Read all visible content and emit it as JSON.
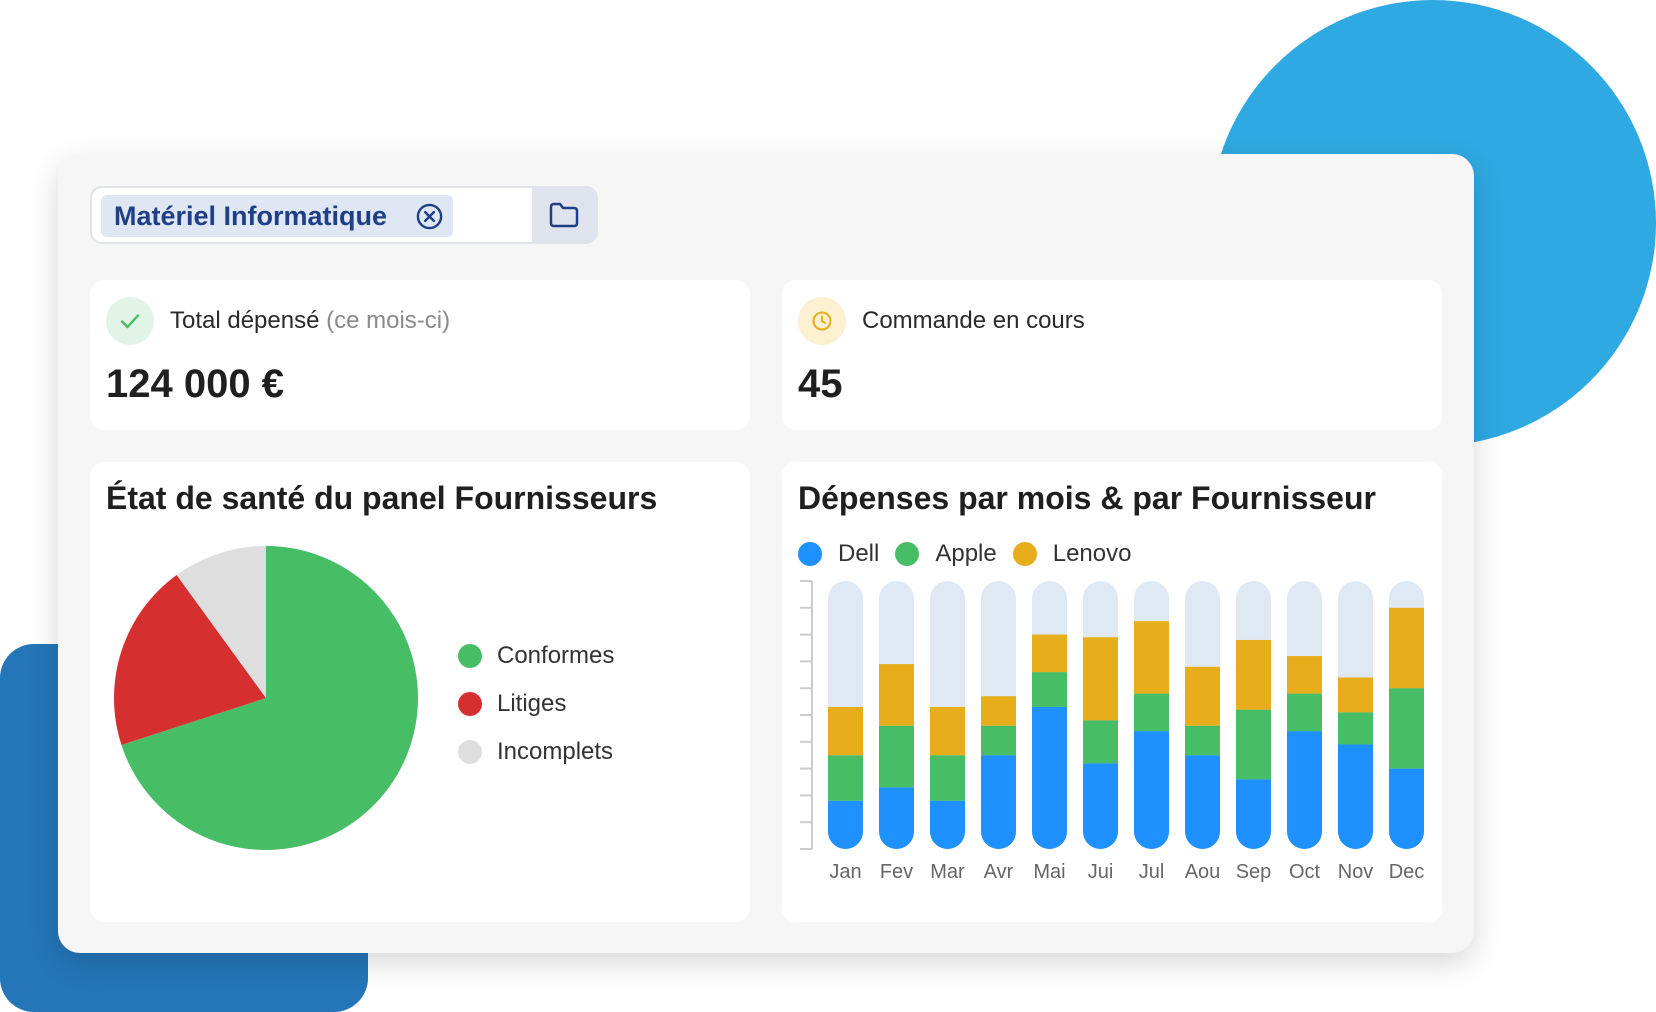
{
  "colors": {
    "background_circle": "#2fa9e1",
    "background_rect": "#2476b8",
    "green": "#47bd65",
    "red": "#d62f2f",
    "grey": "#dedede",
    "blue": "#1e90ff",
    "yellow": "#e8ad1a",
    "bar_track": "#dfe9f4",
    "chip_text": "#1f3f86"
  },
  "filter": {
    "chip_label": "Matériel Informatique",
    "chip_close_icon": "close-circle-icon",
    "folder_icon": "folder-icon"
  },
  "kpis": [
    {
      "icon": "check-icon",
      "title": "Total dépensé",
      "subtitle": "(ce mois-ci)",
      "value": "124 000 €"
    },
    {
      "icon": "clock-icon",
      "title": "Commande en cours",
      "subtitle": "",
      "value": "45"
    }
  ],
  "health_card": {
    "title": "État de santé du panel Fournisseurs"
  },
  "spend_card": {
    "title": "Dépenses par mois & par Fournisseur"
  },
  "chart_data": [
    {
      "type": "pie",
      "title": "État de santé du panel Fournisseurs",
      "categories": [
        "Conformes",
        "Litiges",
        "Incomplets"
      ],
      "values": [
        70,
        20,
        10
      ],
      "colors": [
        "#47bd65",
        "#d62f2f",
        "#dedede"
      ],
      "legend": "right"
    },
    {
      "type": "bar",
      "stacked": true,
      "title": "Dépenses par mois & par Fournisseur",
      "categories": [
        "Jan",
        "Fev",
        "Mar",
        "Avr",
        "Mai",
        "Jui",
        "Jul",
        "Aou",
        "Sep",
        "Oct",
        "Nov",
        "Dec"
      ],
      "series": [
        {
          "name": "Dell",
          "color": "#1e90ff",
          "values": [
            18,
            23,
            18,
            35,
            53,
            32,
            44,
            35,
            26,
            44,
            39,
            30
          ]
        },
        {
          "name": "Apple",
          "color": "#47bd65",
          "values": [
            17,
            23,
            17,
            11,
            13,
            16,
            14,
            11,
            26,
            14,
            12,
            30
          ]
        },
        {
          "name": "Lenovo",
          "color": "#e8ad1a",
          "values": [
            18,
            23,
            18,
            11,
            14,
            31,
            27,
            22,
            26,
            14,
            13,
            30
          ]
        }
      ],
      "ylim": [
        0,
        100
      ],
      "ytick_count": 11,
      "legend": "top-left",
      "grid": false
    }
  ]
}
